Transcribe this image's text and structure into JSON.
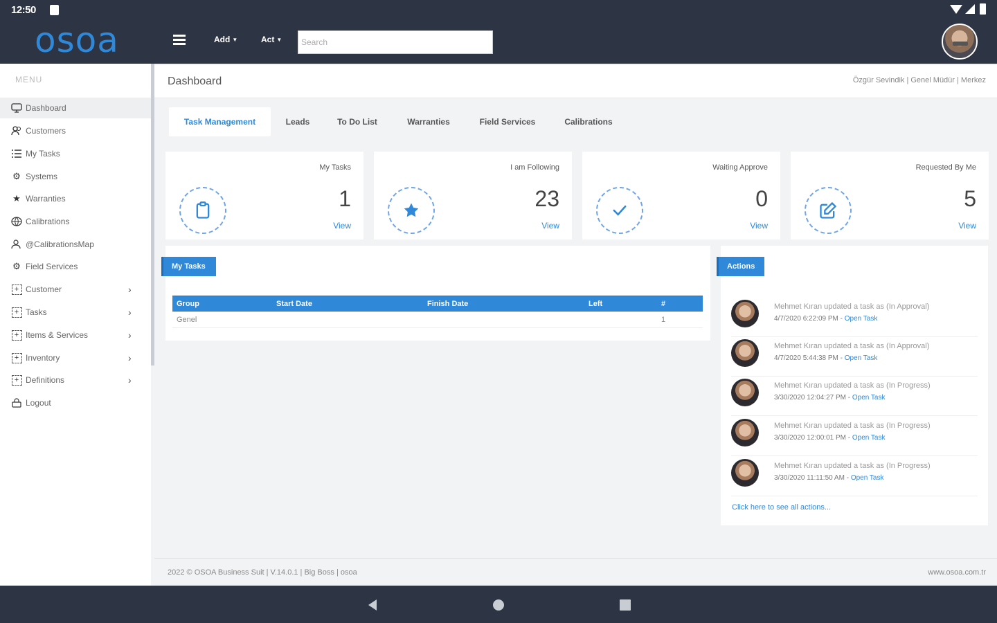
{
  "status_bar": {
    "time": "12:50"
  },
  "app": {
    "logo": "osoa",
    "brand_color": "#2f88d8",
    "header_color": "#2d3443"
  },
  "topbar": {
    "menu_add": "Add",
    "menu_act": "Act",
    "search_placeholder": "Search"
  },
  "sidebar": {
    "title": "MENU",
    "items": [
      {
        "label": "Dashboard",
        "icon": "monitor-icon",
        "active": true
      },
      {
        "label": "Customers",
        "icon": "users-icon"
      },
      {
        "label": "My Tasks",
        "icon": "list-icon"
      },
      {
        "label": "Systems",
        "icon": "gear-icon"
      },
      {
        "label": "Warranties",
        "icon": "star-icon"
      },
      {
        "label": "Calibrations",
        "icon": "globe-icon"
      },
      {
        "label": "@CalibrationsMap",
        "icon": "map-user-icon"
      },
      {
        "label": "Field Services",
        "icon": "cogs-icon"
      },
      {
        "label": "Customer",
        "icon": "plus-box-icon",
        "expandable": true
      },
      {
        "label": "Tasks",
        "icon": "plus-box-icon",
        "expandable": true
      },
      {
        "label": "Items & Services",
        "icon": "plus-box-icon",
        "expandable": true
      },
      {
        "label": "Inventory",
        "icon": "plus-box-icon",
        "expandable": true
      },
      {
        "label": "Definitions",
        "icon": "plus-box-icon",
        "expandable": true
      },
      {
        "label": "Logout",
        "icon": "lock-icon"
      }
    ]
  },
  "page": {
    "title": "Dashboard",
    "user_info": "Özgür Sevindik | Genel Müdür | Merkez"
  },
  "tabs": [
    "Task Management",
    "Leads",
    "To Do List",
    "Warranties",
    "Field Services",
    "Calibrations"
  ],
  "cards": [
    {
      "label": "My Tasks",
      "count": "1",
      "link": "View",
      "icon": "clipboard-icon"
    },
    {
      "label": "I am Following",
      "count": "23",
      "link": "View",
      "icon": "star-icon"
    },
    {
      "label": "Waiting Approve",
      "count": "0",
      "link": "View",
      "icon": "check-icon"
    },
    {
      "label": "Requested By Me",
      "count": "5",
      "link": "View",
      "icon": "edit-icon"
    }
  ],
  "my_tasks": {
    "tag": "My Tasks",
    "columns": [
      "Group",
      "Start Date",
      "Finish Date",
      "Left",
      "#"
    ],
    "rows": [
      [
        "Genel",
        "",
        "",
        "",
        "1"
      ]
    ]
  },
  "actions": {
    "tag": "Actions",
    "items": [
      {
        "text": "Mehmet Kıran updated a task as (In Approval)",
        "date": "4/7/2020 6:22:09 PM",
        "link": "Open Task"
      },
      {
        "text": "Mehmet Kıran updated a task as (In Approval)",
        "date": "4/7/2020 5:44:38 PM",
        "link": "Open Task"
      },
      {
        "text": "Mehmet Kıran updated a task as (In Progress)",
        "date": "3/30/2020 12:04:27 PM",
        "link": "Open Task"
      },
      {
        "text": "Mehmet Kıran updated a task as (In Progress)",
        "date": "3/30/2020 12:00:01 PM",
        "link": "Open Task"
      },
      {
        "text": "Mehmet Kıran updated a task as (In Progress)",
        "date": "3/30/2020 11:11:50 AM",
        "link": "Open Task"
      }
    ],
    "see_all": "Click here to see all actions..."
  },
  "footer": {
    "left": "2022 © OSOA Business Suit | V.14.0.1 | Big Boss | osoa",
    "right": "www.osoa.com.tr"
  }
}
